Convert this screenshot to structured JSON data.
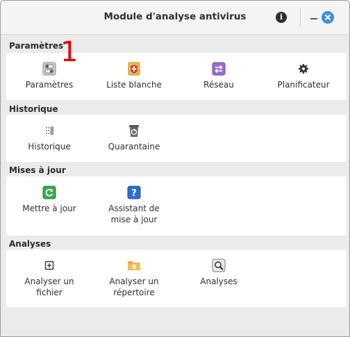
{
  "window": {
    "title": "Module d'analyse antivirus"
  },
  "annotation": "1",
  "sections": [
    {
      "heading": "Paramètres",
      "items": [
        {
          "label": "Paramètres",
          "icon": "toggle-settings-icon"
        },
        {
          "label": "Liste blanche",
          "icon": "whitelist-shield-icon"
        },
        {
          "label": "Réseau",
          "icon": "network-arrows-icon"
        },
        {
          "label": "Planificateur",
          "icon": "gear-icon"
        }
      ]
    },
    {
      "heading": "Historique",
      "items": [
        {
          "label": "Historique",
          "icon": "history-list-icon"
        },
        {
          "label": "Quarantaine",
          "icon": "trash-recycle-icon"
        }
      ]
    },
    {
      "heading": "Mises à jour",
      "items": [
        {
          "label": "Mettre à jour",
          "icon": "refresh-icon"
        },
        {
          "label": "Assistant de mise à jour",
          "icon": "help-question-icon"
        }
      ]
    },
    {
      "heading": "Analyses",
      "items": [
        {
          "label": "Analyser un fichier",
          "icon": "add-file-icon"
        },
        {
          "label": "Analyser un répertoire",
          "icon": "folder-icon"
        },
        {
          "label": "Analyses",
          "icon": "magnifier-icon"
        }
      ]
    }
  ]
}
